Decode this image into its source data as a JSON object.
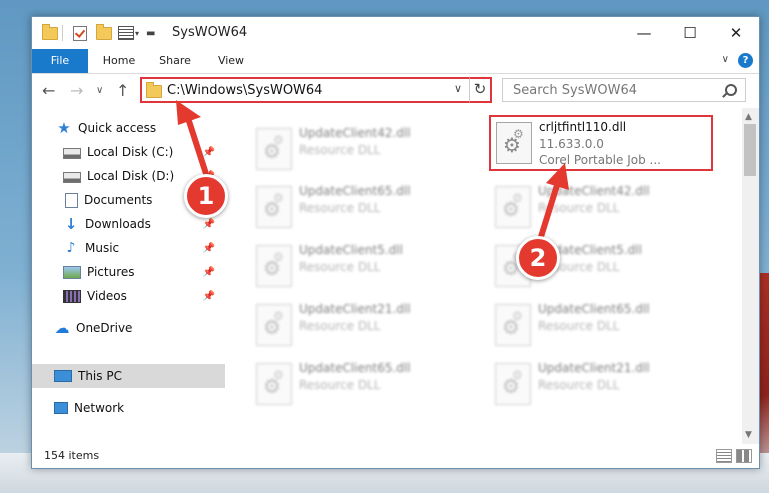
{
  "window": {
    "title": "SysWOW64",
    "minimize_glyph": "—",
    "maximize_glyph": "☐",
    "close_glyph": "✕"
  },
  "ribbon": {
    "tabs": [
      "File",
      "Home",
      "Share",
      "View"
    ],
    "help_glyph": "?",
    "collapse_glyph": "∨"
  },
  "nav": {
    "back_glyph": "←",
    "forward_glyph": "→",
    "recent_glyph": "∨",
    "up_glyph": "↑",
    "address": "C:\\Windows\\SysWOW64",
    "address_chevron": "∨",
    "refresh_glyph": "↻",
    "search_placeholder": "Search SysWOW64"
  },
  "sidebar": {
    "pin_glyph": "📌",
    "items": [
      {
        "label": "Quick access",
        "icon": "star-icon"
      },
      {
        "label": "Local Disk (C:)",
        "icon": "disk-icon"
      },
      {
        "label": "Local Disk (D:)",
        "icon": "disk-icon"
      },
      {
        "label": "Documents",
        "icon": "documents-icon"
      },
      {
        "label": "Downloads",
        "icon": "downloads-icon"
      },
      {
        "label": "Music",
        "icon": "music-icon"
      },
      {
        "label": "Pictures",
        "icon": "pictures-icon"
      },
      {
        "label": "Videos",
        "icon": "videos-icon"
      },
      {
        "label": "OneDrive",
        "icon": "onedrive-icon"
      },
      {
        "label": "This PC",
        "icon": "this-pc-icon",
        "selected": true
      },
      {
        "label": "Network",
        "icon": "network-icon"
      }
    ]
  },
  "files": {
    "highlighted": {
      "name": "crljtfintl110.dll",
      "version": "11.633.0.0",
      "description": "Corel Portable Job ..."
    },
    "left_column": [
      {
        "name": "UpdateClient42.dll",
        "type": "Resource DLL"
      },
      {
        "name": "UpdateClient65.dll",
        "type": "Resource DLL"
      },
      {
        "name": "UpdateClient5.dll",
        "type": "Resource DLL"
      },
      {
        "name": "UpdateClient21.dll",
        "type": "Resource DLL"
      },
      {
        "name": "UpdateClient65.dll",
        "type": "Resource DLL"
      }
    ],
    "right_column": [
      {
        "name": "UpdateClient42.dll",
        "type": "Resource DLL"
      },
      {
        "name": "UpdateClient5.dll",
        "type": "Resource DLL"
      },
      {
        "name": "UpdateClient65.dll",
        "type": "Resource DLL"
      },
      {
        "name": "UpdateClient21.dll",
        "type": "Resource DLL"
      }
    ]
  },
  "status": {
    "item_count": "154 items"
  },
  "callouts": {
    "one": "1",
    "two": "2"
  },
  "colors": {
    "accent": "#1979ca",
    "highlight_red": "#e0363b",
    "callout_red": "#e4392f"
  }
}
